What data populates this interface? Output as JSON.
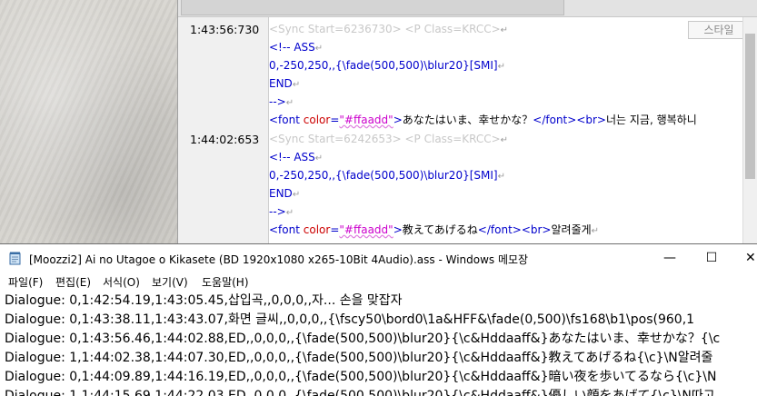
{
  "editor": {
    "style_button_label": "스타일",
    "times": [
      "1:43:56:730",
      "1:44:02:653"
    ],
    "block1": {
      "sync_open": "<Sync ",
      "sync_attr": "Start",
      "sync_eq": "=6236730> <P ",
      "class_attr": "Class",
      "class_val": "=KRCC>",
      "comment_open": "<!-- ASS",
      "pos_line": "0,-250,250,,{\\fade(500,500)\\blur20}[SMI]",
      "end_line": "END",
      "comment_close": "-->",
      "font_open": "<font ",
      "color_attr": "color",
      "color_eq": "=",
      "color_val": "\"#ffaadd\"",
      "font_gt": ">",
      "jp_text": "あなたはいま、幸せかな？",
      "font_close": "</font>",
      "br": "<br>",
      "kr_text": "너는 지금, 행복하니"
    },
    "block2": {
      "sync_open": "<Sync ",
      "sync_attr": "Start",
      "sync_eq": "=6242653> <P ",
      "class_attr": "Class",
      "class_val": "=KRCC>",
      "comment_open": "<!-- ASS",
      "pos_line": "0,-250,250,,{\\fade(500,500)\\blur20}[SMI]",
      "end_line": "END",
      "comment_close": "-->",
      "font_open": "<font ",
      "color_attr": "color",
      "color_eq": "=",
      "color_val": "\"#ffaadd\"",
      "font_gt": ">",
      "jp_text": "教えてあげるね",
      "font_close": "</font>",
      "br": "<br>",
      "kr_text": "알려줄게"
    },
    "crlf_glyph": "↵"
  },
  "notepad": {
    "title": "[Moozzi2] Ai no Utagoe o Kikasete (BD 1920x1080 x265-10Bit 4Audio).ass - Windows 메모장",
    "window_buttons": {
      "minimize": "—",
      "maximize": "☐",
      "close": "✕"
    },
    "menu": [
      "파일(F)",
      "편집(E)",
      "서식(O)",
      "보기(V)",
      "도움말(H)"
    ],
    "lines": [
      "Dialogue: 0,1:42:54.19,1:43:05.45,삽입곡,,0,0,0,,자... 손을 맞잡자",
      "Dialogue: 0,1:43:38.11,1:43:43.07,화면 글씨,,0,0,0,,{\\fscy50\\bord0\\1a&HFF&\\fade(0,500)\\fs168\\b1\\pos(960,1",
      "Dialogue: 0,1:43:56.46,1:44:02.88,ED,,0,0,0,,{\\fade(500,500)\\blur20}{\\c&Hddaaff&}あなたはいま、幸せかな？{\\c",
      "Dialogue: 1,1:44:02.38,1:44:07.30,ED,,0,0,0,,{\\fade(500,500)\\blur20}{\\c&Hddaaff&}教えてあげるね{\\c}\\N알려줄",
      "Dialogue: 0,1:44:09.89,1:44:16.19,ED,,0,0,0,,{\\fade(500,500)\\blur20}{\\c&Hddaaff&}暗い夜を歩いてるなら{\\c}\\N",
      "Dialogue: 1,1:44:15.69,1:44:22.03,ED,,0,0,0,,{\\fade(500,500)\\blur20}{\\c&Hddaaff&}優しい顔をあげて{\\c}\\N따고"
    ]
  }
}
